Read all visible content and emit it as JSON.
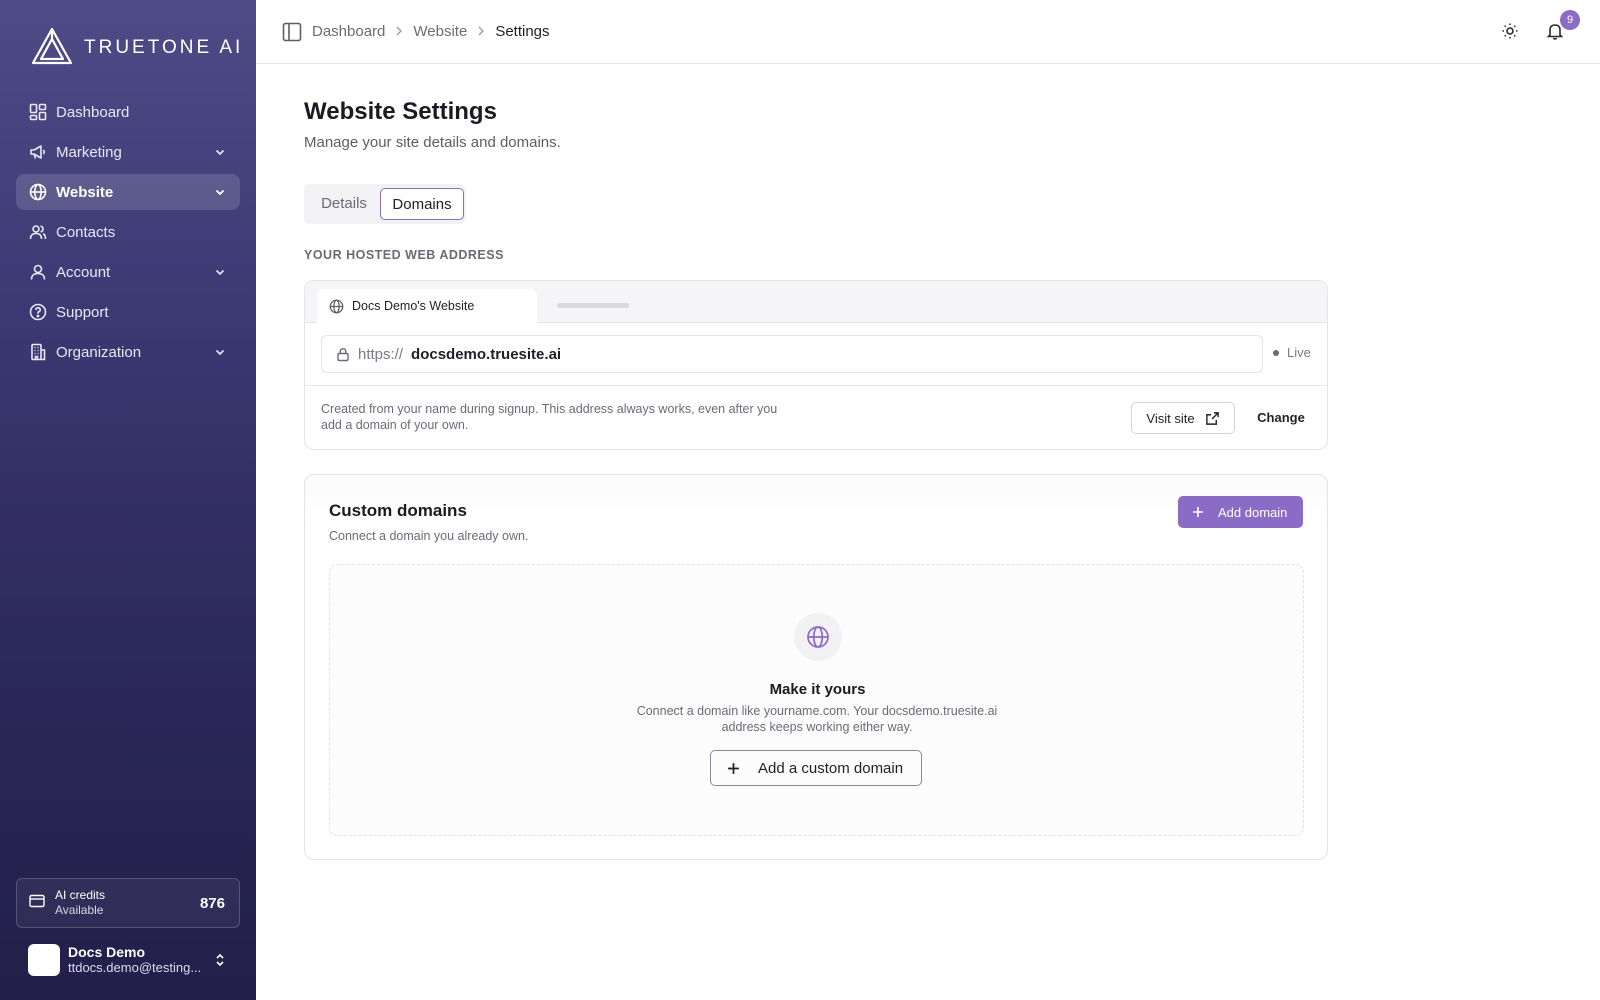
{
  "brand": {
    "name": "TRUETONE AI"
  },
  "sidebar": {
    "items": [
      {
        "label": "Dashboard",
        "icon": "dashboard-grid-icon",
        "has_chevron": false,
        "active": false
      },
      {
        "label": "Marketing",
        "icon": "megaphone-icon",
        "has_chevron": true,
        "active": false
      },
      {
        "label": "Website",
        "icon": "globe-icon",
        "has_chevron": true,
        "active": true
      },
      {
        "label": "Contacts",
        "icon": "users-icon",
        "has_chevron": false,
        "active": false
      },
      {
        "label": "Account",
        "icon": "user-icon",
        "has_chevron": true,
        "active": false
      },
      {
        "label": "Support",
        "icon": "help-circle-icon",
        "has_chevron": false,
        "active": false
      },
      {
        "label": "Organization",
        "icon": "building-icon",
        "has_chevron": true,
        "active": false
      }
    ],
    "credits": {
      "title": "AI credits",
      "subtitle": "Available",
      "value": "876"
    },
    "user": {
      "name": "Docs Demo",
      "email": "ttdocs.demo@testing..."
    }
  },
  "header": {
    "breadcrumb": [
      "Dashboard",
      "Website",
      "Settings"
    ],
    "notification_count": "9"
  },
  "page": {
    "title": "Website Settings",
    "subtitle": "Manage your site details and domains.",
    "tabs": [
      {
        "label": "Details",
        "active": false
      },
      {
        "label": "Domains",
        "active": true
      }
    ]
  },
  "hosted": {
    "section_label": "YOUR HOSTED WEB ADDRESS",
    "site_tab": "Docs Demo's Website",
    "protocol": "https://",
    "domain": "docsdemo.truesite.ai",
    "status": "Live",
    "note": "Created from your name during signup. This address always works, even after you add a domain of your own.",
    "visit_label": "Visit site",
    "change_label": "Change"
  },
  "custom_domains": {
    "title": "Custom domains",
    "subtitle": "Connect a domain you already own.",
    "add_label": "Add domain",
    "empty": {
      "title": "Make it yours",
      "description": "Connect a domain like yourname.com. Your docsdemo.truesite.ai address keeps working either way.",
      "button_label": "Add a custom domain"
    }
  },
  "colors": {
    "accent": "#8a6cc6",
    "sidebar_top": "#4f4b87",
    "sidebar_bottom": "#221f4a"
  }
}
